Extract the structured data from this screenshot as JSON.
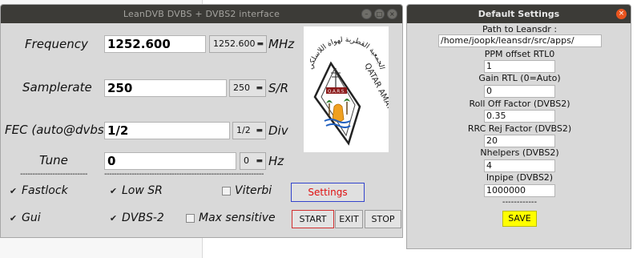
{
  "main_window": {
    "title": "LeanDVB DVBS + DVBS2 interface",
    "frequency": {
      "label": "Frequency",
      "value": "1252.600",
      "combo": "1252.600",
      "unit": "MHz"
    },
    "samplerate": {
      "label": "Samplerate",
      "value": "250",
      "combo": "250",
      "unit": "S/R"
    },
    "fec": {
      "label": "FEC (auto@dvbs2)",
      "value": "1/2",
      "combo": "1/2",
      "unit": "Div"
    },
    "tune": {
      "label": "Tune",
      "value": "0",
      "combo": "0",
      "unit": "Hz"
    },
    "separator_left": "----------------------------------",
    "separator_right": "----------------------------------------------------------------",
    "checkboxes": {
      "fastlock": {
        "label": "Fastlock",
        "checked": true
      },
      "lowsr": {
        "label": "Low SR",
        "checked": true
      },
      "viterbi": {
        "label": "Viterbi",
        "checked": false
      },
      "gui": {
        "label": "Gui",
        "checked": true
      },
      "dvbs2": {
        "label": "DVBS-2",
        "checked": true
      },
      "maxsens": {
        "label": "Max sensitive",
        "checked": false
      }
    },
    "buttons": {
      "settings": "Settings",
      "start": "START",
      "exit": "EXIT",
      "stop": "STOP"
    },
    "logo": {
      "top_arc": "الجمعية القطرية لهواة اللاسلكي",
      "badge": "Q.A.R.S.",
      "side_text": "QATAR AMATEUR RADIO SOCIETY"
    },
    "icons": {
      "minimize": "minimize-icon",
      "maximize": "maximize-icon",
      "close": "close-icon",
      "dropdown": "chevron-down-icon"
    }
  },
  "settings_window": {
    "title": "Default Settings",
    "fields": [
      {
        "label": "Path to Leansdr :",
        "value": "/home/joopk/leansdr/src/apps/"
      },
      {
        "label": "PPM offset RTL0",
        "value": "1"
      },
      {
        "label": "Gain RTL (0=Auto)",
        "value": "0"
      },
      {
        "label": "Roll Off Factor (DVBS2)",
        "value": "0.35"
      },
      {
        "label": "RRC Rej Factor (DVBS2)",
        "value": "20"
      },
      {
        "label": "Nhelpers (DVBS2)",
        "value": "4"
      },
      {
        "label": "Inpipe (DVBS2)",
        "value": "1000000"
      }
    ],
    "separator": "------------",
    "save": "SAVE"
  },
  "colors": {
    "titlebar": "#3c3b37",
    "settings_text": "#e01010",
    "settings_border": "#3344cc",
    "save_bg": "#ffff00",
    "close": "#e9541e"
  }
}
